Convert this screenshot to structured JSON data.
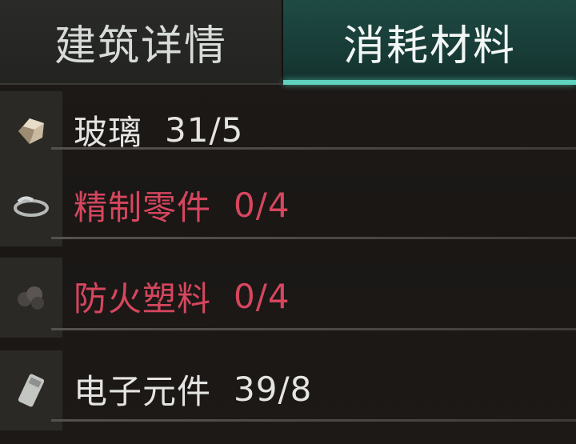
{
  "tabs": [
    {
      "label": "建筑详情",
      "active": false
    },
    {
      "label": "消耗材料",
      "active": true
    }
  ],
  "materials": [
    {
      "name": "玻璃",
      "count": "31/5",
      "sufficient": true,
      "icon": "glass-icon"
    },
    {
      "name": "精制零件",
      "count": "0/4",
      "sufficient": false,
      "icon": "refined-parts-icon"
    },
    {
      "name": "防火塑料",
      "count": "0/4",
      "sufficient": false,
      "icon": "fireproof-plastic-icon"
    },
    {
      "name": "电子元件",
      "count": "39/8",
      "sufficient": true,
      "icon": "electronic-component-icon"
    }
  ],
  "colors": {
    "accent": "#5fd3bf",
    "sufficient_text": "#e4e4e2",
    "insufficient_text": "#d6465e"
  }
}
